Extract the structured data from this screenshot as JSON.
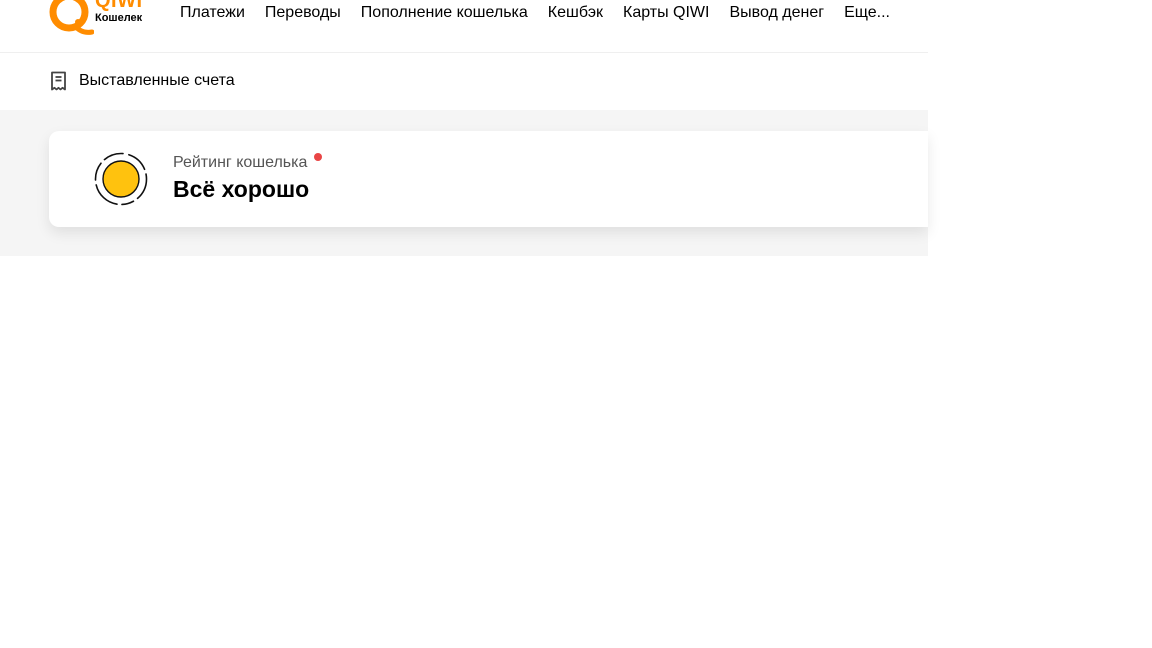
{
  "logo": {
    "wordmark": "QIWI",
    "subtitle": "Кошелек",
    "brand_color": "#ff8c00"
  },
  "nav": {
    "items": [
      {
        "label": "Платежи"
      },
      {
        "label": "Переводы"
      },
      {
        "label": "Пополнение кошелька"
      },
      {
        "label": "Кешбэк"
      },
      {
        "label": "Карты QIWI"
      },
      {
        "label": "Вывод денег"
      },
      {
        "label": "Еще..."
      }
    ]
  },
  "invoices": {
    "label": "Выставленные счета",
    "icon": "receipt-icon"
  },
  "rating": {
    "caption": "Рейтинг кошелька",
    "status": "Всё хорошо",
    "icon": "sun-rating-icon",
    "sun_color": "#ffc20e",
    "dot_color": "#e94545"
  }
}
